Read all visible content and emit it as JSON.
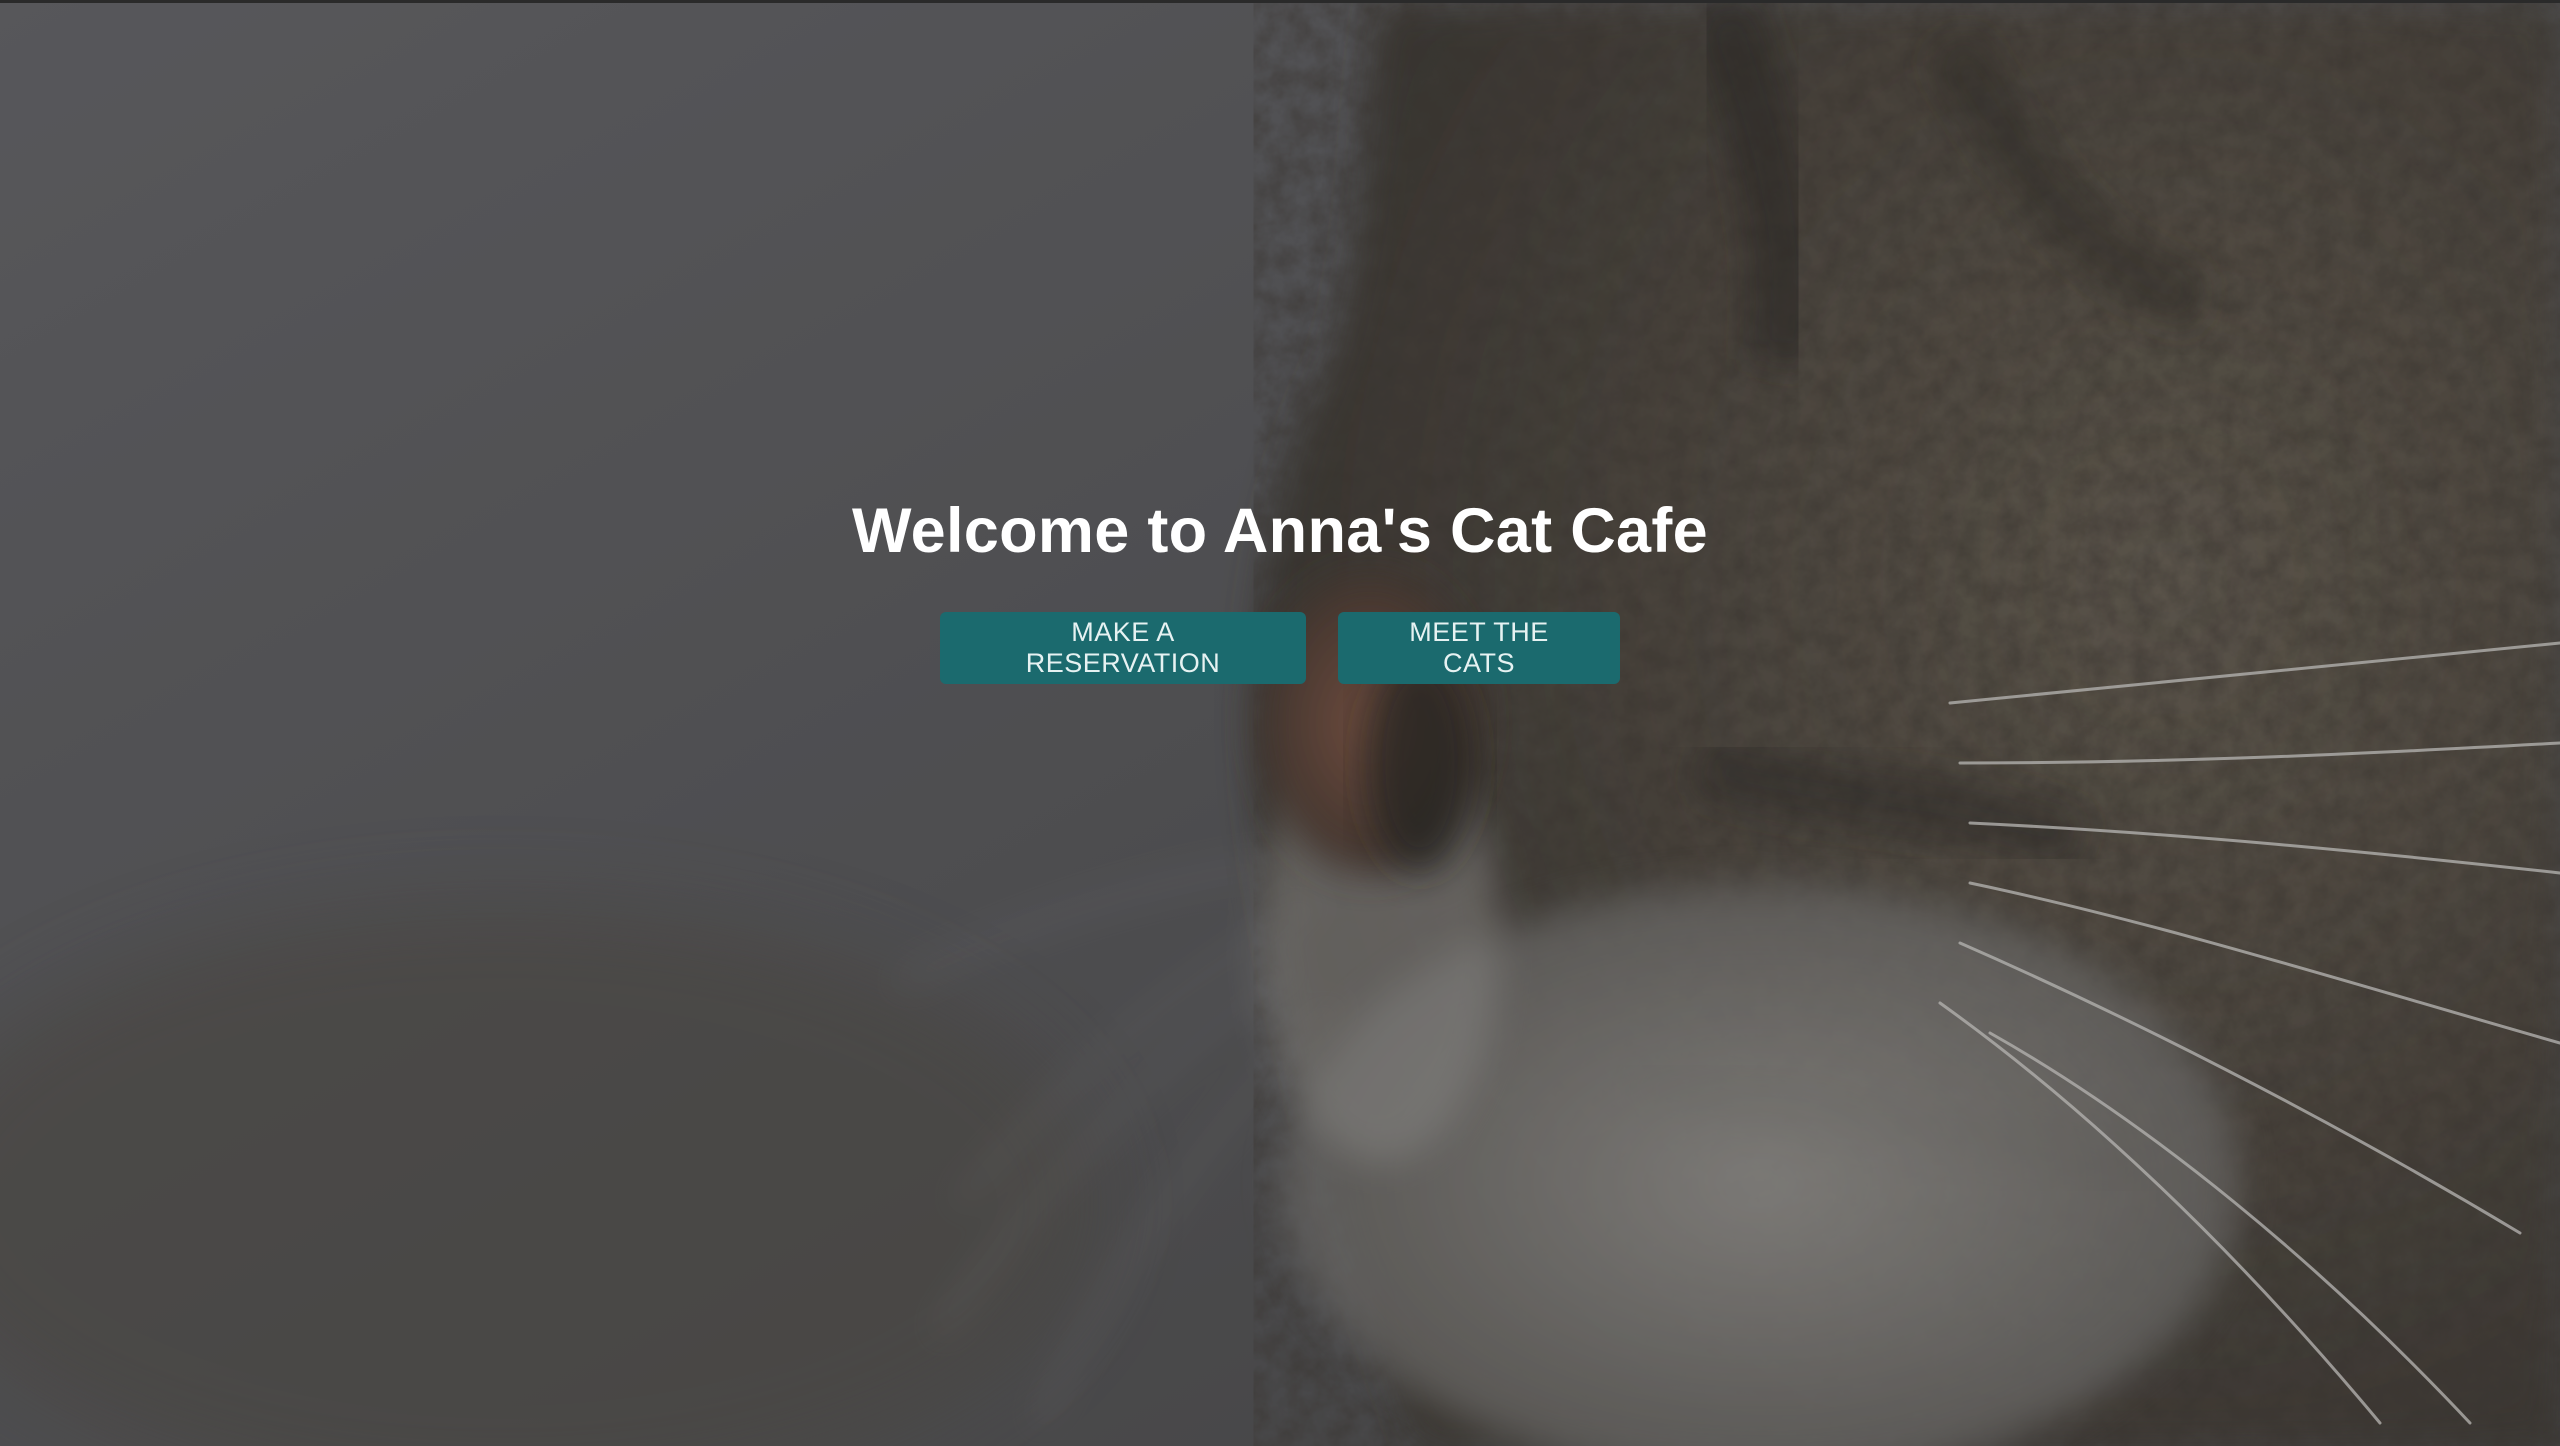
{
  "hero": {
    "title": "Welcome to Anna's Cat Cafe",
    "background_image": "tabby-cat-closeup-photo",
    "buttons": [
      {
        "label": "MAKE A RESERVATION"
      },
      {
        "label": "MEET THE CATS"
      }
    ]
  },
  "colors": {
    "button_bg": "#1b6a6e",
    "button_text": "#e6f2f2",
    "title_text": "#ffffff",
    "overlay": "#28282a"
  }
}
